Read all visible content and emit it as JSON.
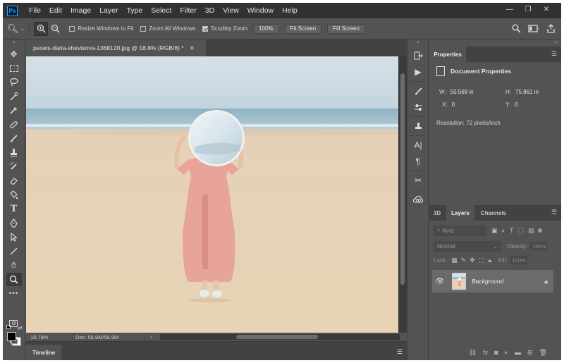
{
  "app": {
    "logo": "Ps",
    "menu": [
      "File",
      "Edit",
      "Image",
      "Layer",
      "Type",
      "Select",
      "Filter",
      "3D",
      "View",
      "Window",
      "Help"
    ],
    "window_controls": {
      "minimize": "—",
      "restore": "❐",
      "close": "✕"
    }
  },
  "options": {
    "tool_icon": "zoom-tool-icon",
    "checkboxes": [
      {
        "label": "Resize Windows to Fit",
        "checked": false
      },
      {
        "label": "Zoom All Windows",
        "checked": false
      },
      {
        "label": "Scrubby Zoom",
        "checked": true
      }
    ],
    "zoom_value": "100%",
    "fit_screen": "Fit Screen",
    "fill_screen": "Fill Screen"
  },
  "document": {
    "tab_title": "pexels-daria-shevtsova-1368120.jpg @ 18.8% (RGB/8) *",
    "zoom_level": "18.78%",
    "doc_info": "Doc: 56.9M/56.9M"
  },
  "timeline": {
    "label": "Timeline"
  },
  "properties": {
    "tab": "Properties",
    "heading": "Document Properties",
    "w": {
      "label": "W:",
      "value": "50.569 in"
    },
    "h": {
      "label": "H:",
      "value": "75.861 in"
    },
    "x": {
      "label": "X:",
      "value": "0"
    },
    "y": {
      "label": "Y:",
      "value": "0"
    },
    "resolution": "Resolution: 72 pixels/inch"
  },
  "layers_panel": {
    "tabs": [
      "3D",
      "Layers",
      "Channels"
    ],
    "active_tab": "Layers",
    "kind_placeholder": "Kind",
    "blend_mode": "Normal",
    "opacity_label": "Opacity:",
    "opacity_value": "100%",
    "lock_label": "Lock:",
    "fill_label": "Fill:",
    "fill_value": "100%",
    "layers": [
      {
        "name": "Background",
        "visible": true,
        "locked": true
      }
    ]
  },
  "colors": {
    "foreground": "#000000",
    "background": "#ffffff",
    "accent": "#31a8ff"
  }
}
